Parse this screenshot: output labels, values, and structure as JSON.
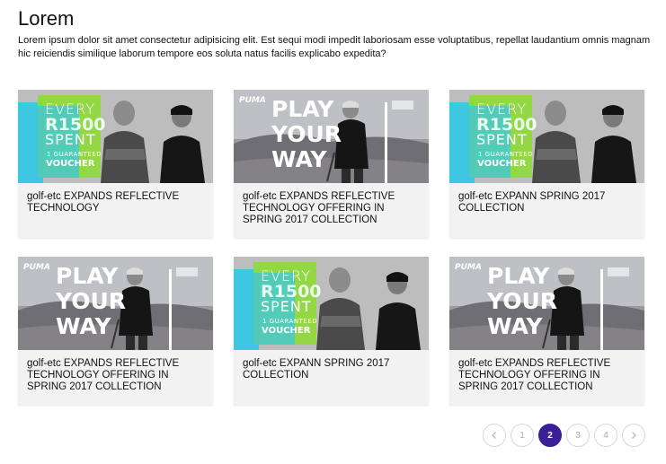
{
  "header": {
    "title": "Lorem",
    "intro": "Lorem ipsum dolor sit amet consectetur adipisicing elit. Est sequi modi impedit laboriosam esse voluptatibus, repellat laudantium omnis magnam hic reiciendis similique laborum tempore eos soluta natus facilis explicabo expedita?"
  },
  "banners": {
    "promo": {
      "line1": "EVERY",
      "line2": "R1500",
      "line3": "SPENT",
      "line4": "1 GUARANTEED",
      "line5": "VOUCHER"
    },
    "play": {
      "brand": "PUMA",
      "word1": "PLAY",
      "word2": "YOUR",
      "word3": "WAY"
    }
  },
  "cards": [
    {
      "image": "promo",
      "title": "golf-etc EXPANDS REFLECTIVE TECHNOLOGY"
    },
    {
      "image": "play",
      "title": "golf-etc EXPANDS REFLECTIVE TECHNOLOGY OFFERING IN SPRING 2017 COLLECTION"
    },
    {
      "image": "promo",
      "title": "golf-etc EXPANN SPRING 2017 COLLECTION"
    },
    {
      "image": "play",
      "title": "golf-etc EXPANDS REFLECTIVE TECHNOLOGY OFFERING IN SPRING 2017 COLLECTION"
    },
    {
      "image": "promo",
      "title": "golf-etc EXPANN SPRING 2017 COLLECTION"
    },
    {
      "image": "play",
      "title": "golf-etc EXPANDS REFLECTIVE TECHNOLOGY OFFERING IN SPRING 2017 COLLECTION"
    }
  ],
  "pagination": {
    "prev_icon": "chevron-left-icon",
    "next_icon": "chevron-right-icon",
    "pages": [
      "1",
      "2",
      "3",
      "4"
    ],
    "current": "2",
    "accent": "#3a1f96"
  },
  "colors": {
    "promo_cyan": "#3ec7e0",
    "promo_green": "#8fd93a",
    "card_bg": "#f2f2f2"
  }
}
